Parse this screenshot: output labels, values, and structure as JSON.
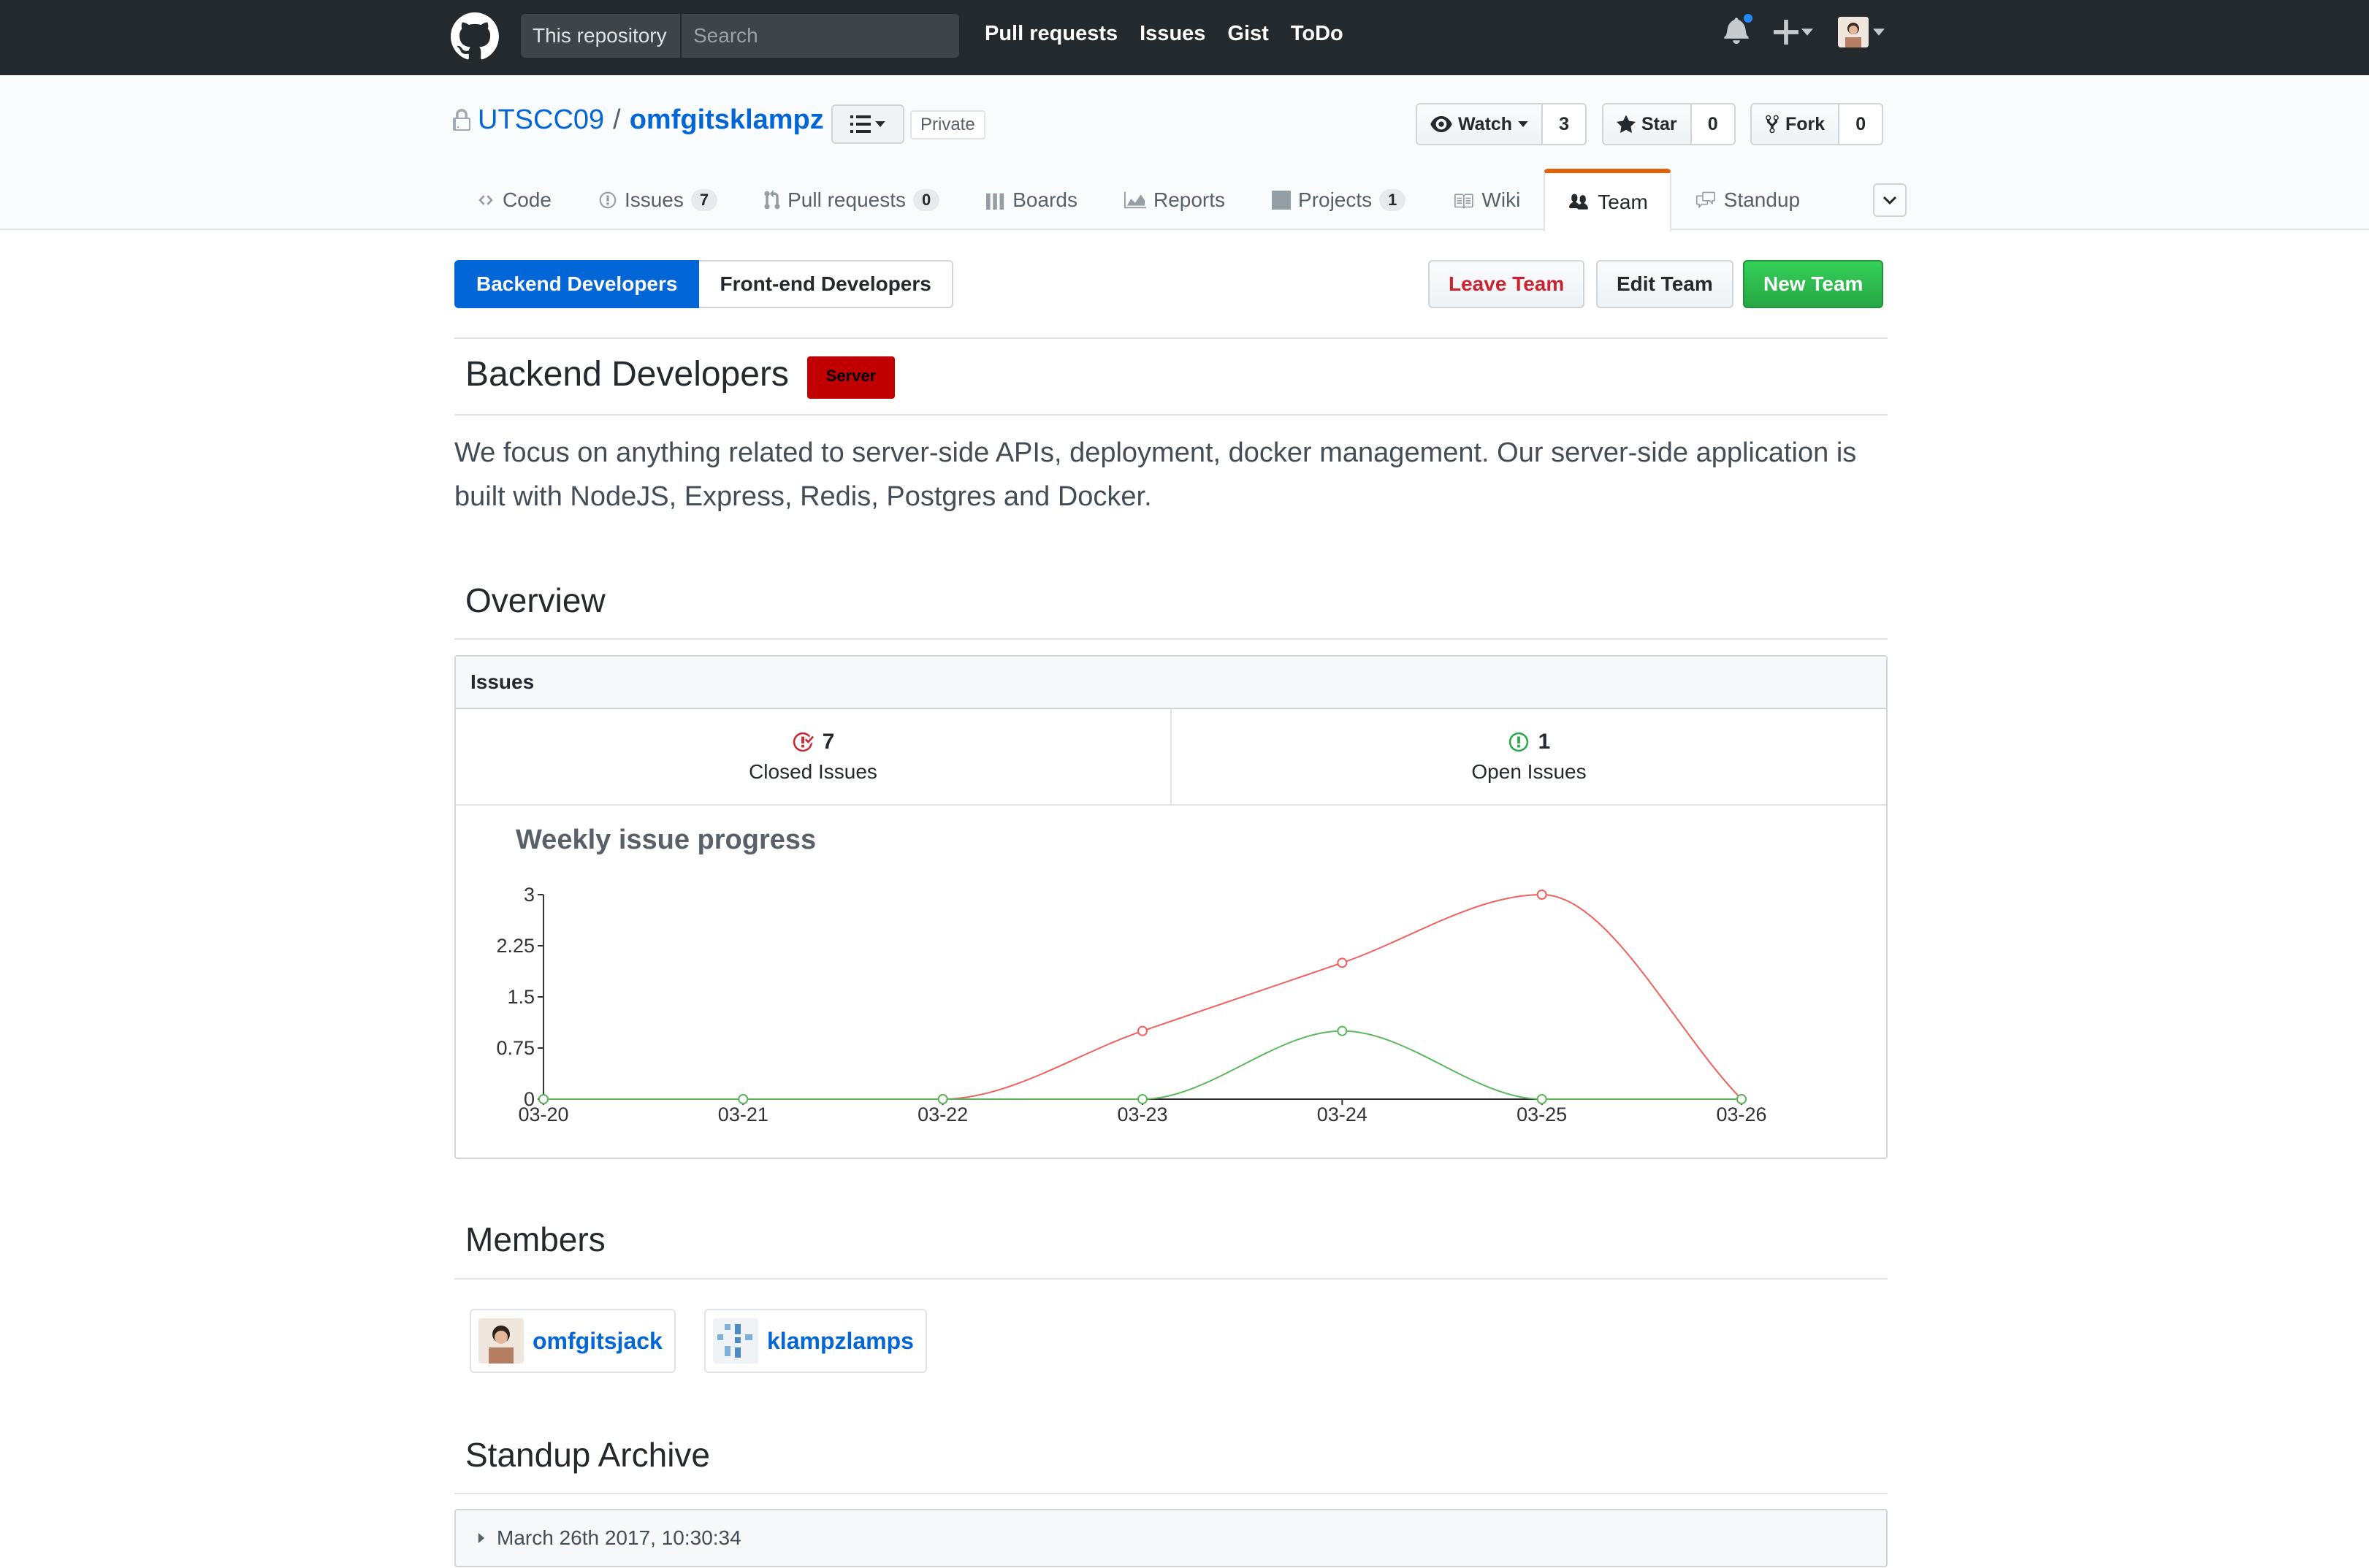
{
  "header": {
    "search_scope": "This repository",
    "search_placeholder": "Search",
    "nav": [
      "Pull requests",
      "Issues",
      "Gist",
      "ToDo"
    ]
  },
  "repo": {
    "owner": "UTSCC09",
    "name": "omfgitsklampz",
    "visibility": "Private",
    "watch_label": "Watch",
    "watch_count": "3",
    "star_label": "Star",
    "star_count": "0",
    "fork_label": "Fork",
    "fork_count": "0"
  },
  "tabs": [
    {
      "label": "Code",
      "icon": "code-icon"
    },
    {
      "label": "Issues",
      "icon": "issue-icon",
      "count": "7"
    },
    {
      "label": "Pull requests",
      "icon": "pull-request-icon",
      "count": "0"
    },
    {
      "label": "Boards",
      "icon": "boards-icon"
    },
    {
      "label": "Reports",
      "icon": "reports-icon"
    },
    {
      "label": "Projects",
      "icon": "project-icon",
      "count": "1"
    },
    {
      "label": "Wiki",
      "icon": "wiki-icon"
    },
    {
      "label": "Team",
      "icon": "team-icon",
      "active": true
    },
    {
      "label": "Standup",
      "icon": "standup-icon"
    }
  ],
  "team_switch": {
    "active": "Backend Developers",
    "other": "Front-end Developers"
  },
  "actions": {
    "leave": "Leave Team",
    "edit": "Edit Team",
    "new": "New Team"
  },
  "team": {
    "title": "Backend Developers",
    "label": "Server",
    "label_color": "#c00000",
    "description": "We focus on anything related to server-side APIs, deployment, docker management. Our server-side application is built with NodeJS, Express, Redis, Postgres and Docker."
  },
  "overview": {
    "heading": "Overview",
    "box_title": "Issues",
    "closed_count": "7",
    "closed_label": "Closed Issues",
    "open_count": "1",
    "open_label": "Open Issues"
  },
  "chart_data": {
    "type": "line",
    "title": "Weekly issue progress",
    "categories": [
      "03-20",
      "03-21",
      "03-22",
      "03-23",
      "03-24",
      "03-25",
      "03-26"
    ],
    "yticks": [
      "0",
      "0.75",
      "1.5",
      "2.25",
      "3"
    ],
    "ylim": [
      0,
      3
    ],
    "series": [
      {
        "color": "#f25f5c",
        "values": [
          0,
          0,
          0,
          1,
          2,
          3,
          0
        ]
      },
      {
        "color": "#5cb85c",
        "values": [
          0,
          0,
          0,
          0,
          1,
          0,
          0
        ]
      }
    ],
    "grid": false,
    "legend": "none"
  },
  "members": {
    "heading": "Members",
    "list": [
      "omfgitsjack",
      "klampzlamps"
    ]
  },
  "standup": {
    "heading": "Standup Archive",
    "entries": [
      "March 26th 2017, 10:30:34"
    ]
  }
}
